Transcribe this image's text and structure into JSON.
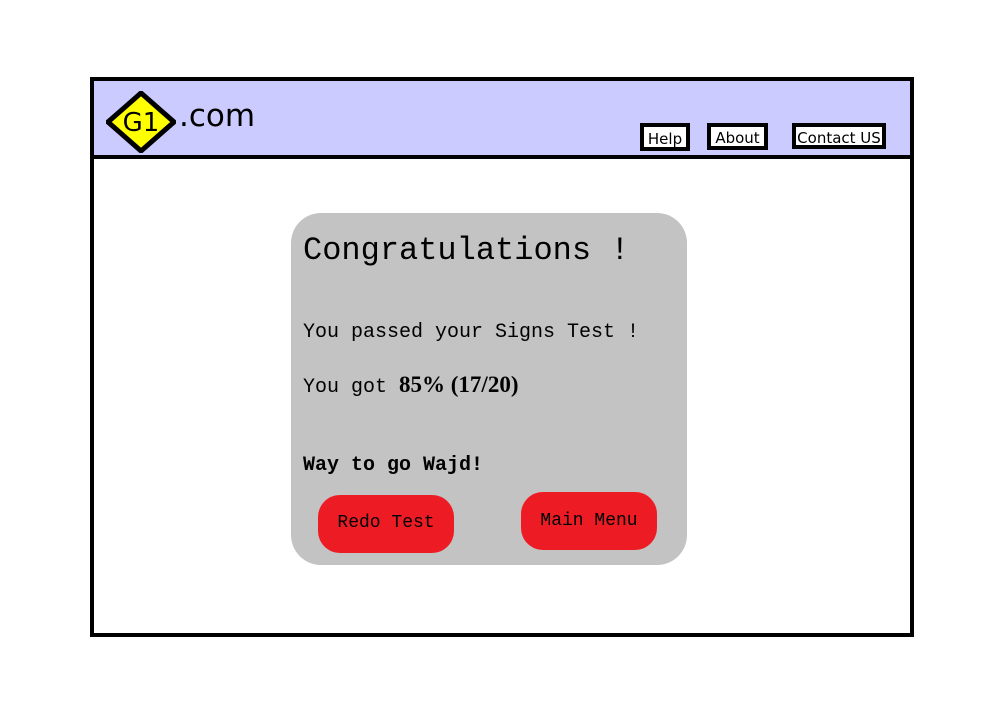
{
  "header": {
    "logo": {
      "badge_text": "G1",
      "suffix": ".com",
      "badge_color": "#ffff00",
      "background_color": "#cbcbff"
    },
    "nav": {
      "help_label": "Help",
      "about_label": "About",
      "contact_label": "Contact US"
    }
  },
  "result_card": {
    "title": "Congratulations !",
    "passed_message": "You passed your Signs Test !",
    "score_prefix": "You got ",
    "score_value": "85% (17/20)",
    "cheer_message": "Way to go Wajd!",
    "redo_button_label": "Redo Test",
    "main_menu_button_label": "Main Menu",
    "card_color": "#c3c3c3",
    "button_color": "#ed1c24"
  }
}
